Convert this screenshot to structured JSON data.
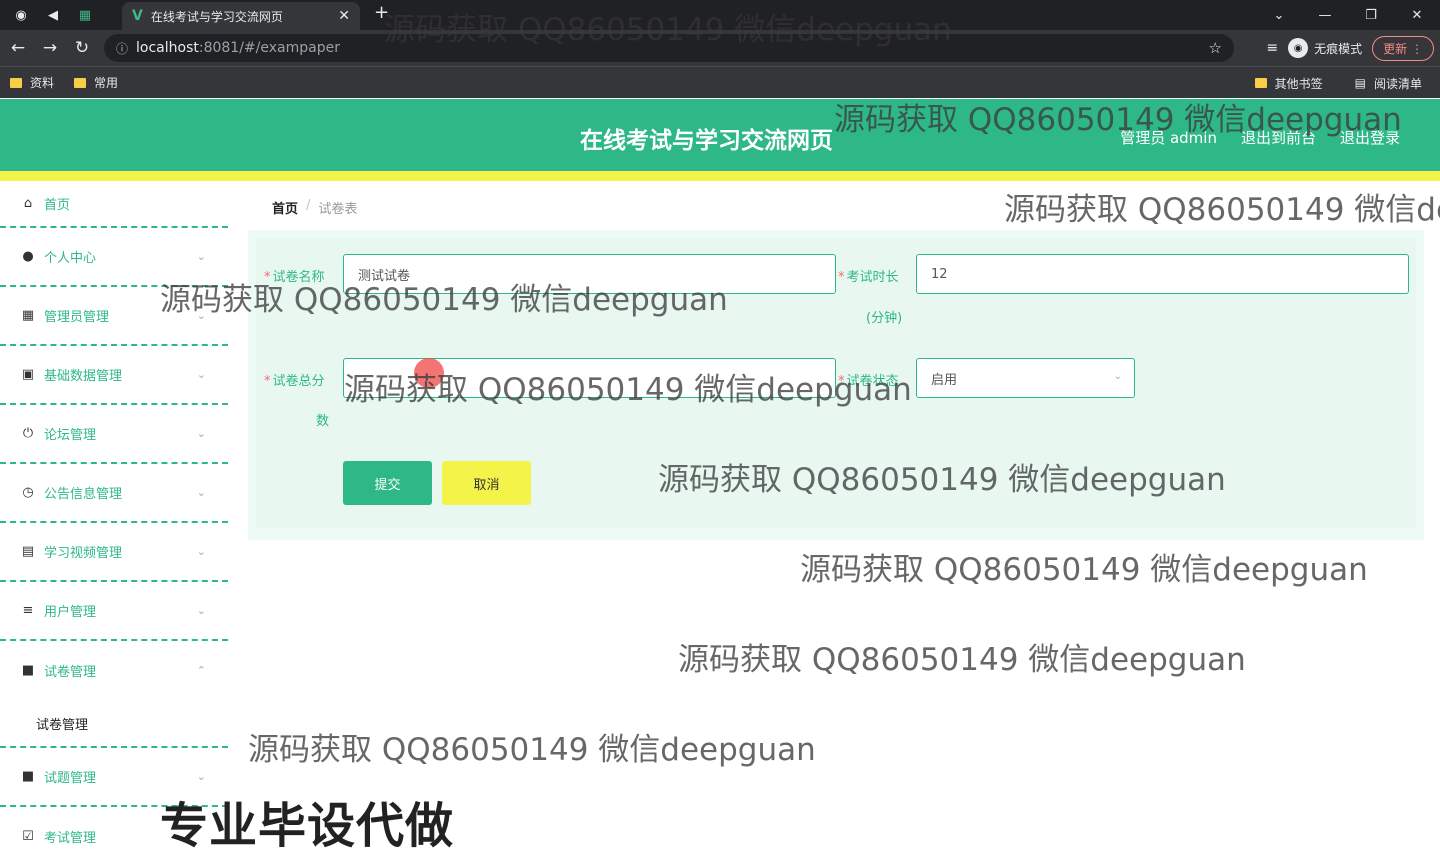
{
  "browser": {
    "tab_title": "在线考试与学习交流网页",
    "url_host": "localhost",
    "url_path": ":8081/#/exampaper",
    "incognito_label": "无痕模式",
    "update_label": "更新",
    "bookmarks": [
      "资料",
      "常用"
    ],
    "bookmarks_right": [
      "其他书签",
      "阅读清单"
    ]
  },
  "header": {
    "title": "在线考试与学习交流网页",
    "user": "管理员 admin",
    "to_front": "退出到前台",
    "logout": "退出登录"
  },
  "sidebar": {
    "items": [
      {
        "label": "首页",
        "icon": "home-icon"
      },
      {
        "label": "个人中心",
        "icon": "user-icon"
      },
      {
        "label": "管理员管理",
        "icon": "grid-icon"
      },
      {
        "label": "基础数据管理",
        "icon": "box-icon"
      },
      {
        "label": "论坛管理",
        "icon": "power-icon"
      },
      {
        "label": "公告信息管理",
        "icon": "clock-icon"
      },
      {
        "label": "学习视频管理",
        "icon": "chart-icon"
      },
      {
        "label": "用户管理",
        "icon": "list-icon"
      },
      {
        "label": "试卷管理",
        "icon": "chat-icon"
      },
      {
        "label": "试题管理",
        "icon": "folder-icon"
      },
      {
        "label": "考试管理",
        "icon": "check-icon"
      }
    ],
    "submenu": "试卷管理"
  },
  "breadcrumb": {
    "home": "首页",
    "sep": "/",
    "current": "试卷表"
  },
  "form": {
    "name_label": "试卷名称",
    "name_value": "测试试卷",
    "duration_label": "考试时长",
    "duration_unit": "(分钟)",
    "duration_value": "12",
    "score_label": "试卷总分",
    "score_label_2": "数",
    "score_value": "",
    "status_label": "试卷状态",
    "status_value": "启用",
    "submit": "提交",
    "cancel": "取消"
  },
  "overlays": {
    "watermark": "源码获取 QQ86050149 微信deepguan",
    "ad": "专业毕设代做"
  }
}
